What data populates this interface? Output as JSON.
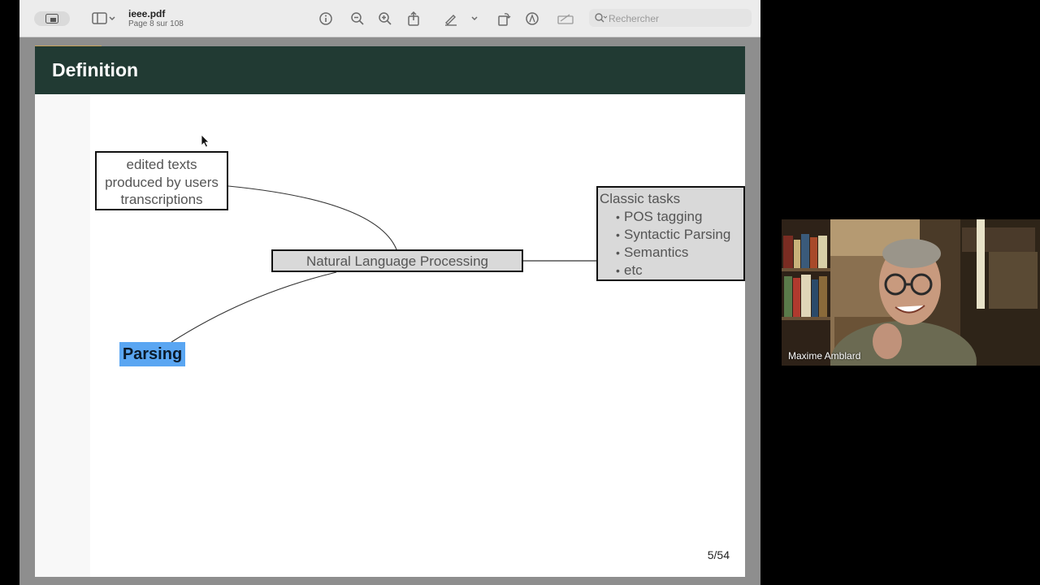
{
  "toolbar": {
    "doc_title": "ieee.pdf",
    "page_info": "Page 8 sur 108",
    "search_placeholder": "Rechercher",
    "icons": [
      "sidebar-icon",
      "chevron-down-icon",
      "info-icon",
      "zoom-out-icon",
      "zoom-in-icon",
      "share-icon",
      "highlight-pen-icon",
      "rotate-icon",
      "markup-icon",
      "signature-icon",
      "search-icon"
    ]
  },
  "slide": {
    "title": "Definition",
    "box_texts": [
      "edited texts",
      "produced by users",
      "transcriptions"
    ],
    "nlp_label": "Natural Language Processing",
    "tasks_title": "Classic tasks",
    "tasks": [
      "POS tagging",
      "Syntactic Parsing",
      "Semantics",
      "etc"
    ],
    "parsing_label": "Parsing",
    "page_number": "5/54",
    "colors": {
      "header": "#213a33",
      "highlight": "#5aa6f2",
      "box_fill": "#d9d9d9"
    }
  },
  "video": {
    "participant_name": "Maxime Amblard"
  }
}
